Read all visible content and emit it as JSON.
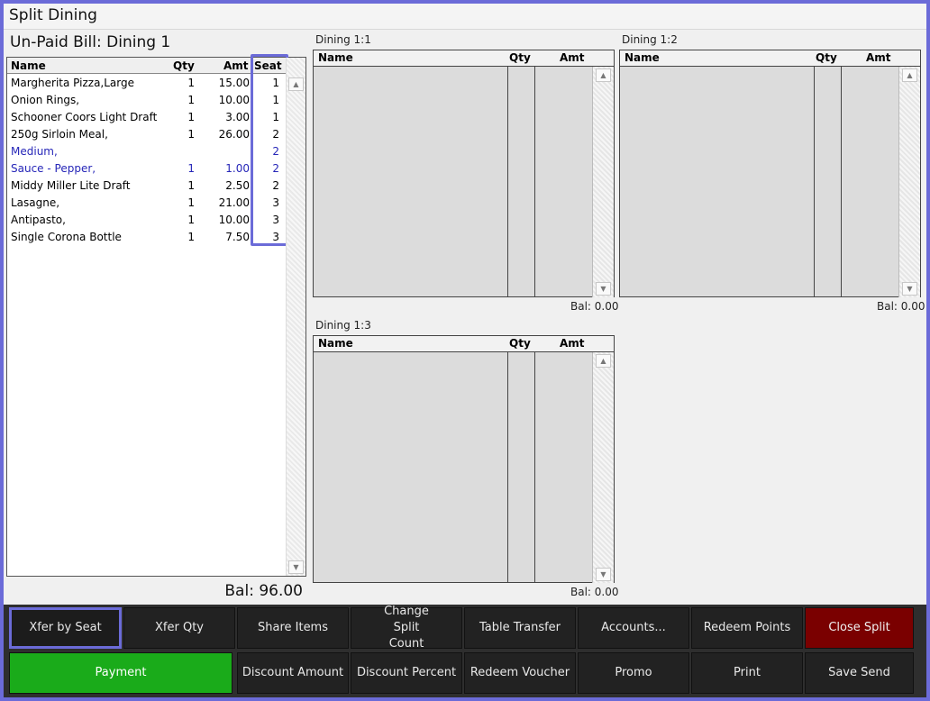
{
  "window": {
    "title": "Split Dining"
  },
  "bill": {
    "title": "Un-Paid Bill: Dining 1",
    "columns": {
      "name": "Name",
      "qty": "Qty",
      "amt": "Amt",
      "seat": "Seat"
    },
    "items": [
      {
        "name": "Margherita Pizza,Large",
        "qty": "1",
        "amt": "15.00",
        "seat": "1",
        "modifier": false
      },
      {
        "name": "Onion Rings,",
        "qty": "1",
        "amt": "10.00",
        "seat": "1",
        "modifier": false
      },
      {
        "name": "Schooner Coors Light Draft",
        "qty": "1",
        "amt": "3.00",
        "seat": "1",
        "modifier": false
      },
      {
        "name": "250g Sirloin Meal,",
        "qty": "1",
        "amt": "26.00",
        "seat": "2",
        "modifier": false
      },
      {
        "name": " Medium,",
        "qty": "",
        "amt": "",
        "seat": "2",
        "modifier": true
      },
      {
        "name": " Sauce - Pepper,",
        "qty": "1",
        "amt": "1.00",
        "seat": "2",
        "modifier": true
      },
      {
        "name": "Middy Miller Lite Draft",
        "qty": "1",
        "amt": "2.50",
        "seat": "2",
        "modifier": false
      },
      {
        "name": "Lasagne,",
        "qty": "1",
        "amt": "21.00",
        "seat": "3",
        "modifier": false
      },
      {
        "name": "Antipasto,",
        "qty": "1",
        "amt": "10.00",
        "seat": "3",
        "modifier": false
      },
      {
        "name": "Single Corona Bottle",
        "qty": "1",
        "amt": "7.50",
        "seat": "3",
        "modifier": false
      }
    ],
    "balance": "Bal: 96.00"
  },
  "splits": [
    {
      "label": "Dining 1:1",
      "columns": {
        "name": "Name",
        "qty": "Qty",
        "amt": "Amt"
      },
      "balance": "Bal: 0.00"
    },
    {
      "label": "Dining 1:2",
      "columns": {
        "name": "Name",
        "qty": "Qty",
        "amt": "Amt"
      },
      "balance": "Bal: 0.00"
    },
    {
      "label": "Dining 1:3",
      "columns": {
        "name": "Name",
        "qty": "Qty",
        "amt": "Amt"
      },
      "balance": "Bal: 0.00"
    }
  ],
  "scroll": {
    "up": "▲",
    "down": "▼"
  },
  "buttons": {
    "row1": [
      {
        "label": "Xfer by Seat",
        "selected": true
      },
      {
        "label": "Xfer Qty"
      },
      {
        "label": "Share Items"
      },
      {
        "label": "Change Split Count"
      },
      {
        "label": "Table Transfer"
      },
      {
        "label": "Accounts..."
      },
      {
        "label": "Redeem Points"
      },
      {
        "label": "Close Split",
        "color": "#7a0000"
      }
    ],
    "row2": [
      {
        "label": "Payment",
        "color": "#1aab1a"
      },
      {
        "label": "Discount Amount"
      },
      {
        "label": "Discount Percent"
      },
      {
        "label": "Redeem Voucher"
      },
      {
        "label": "Promo"
      },
      {
        "label": "Print"
      },
      {
        "label": "Save Send"
      }
    ]
  },
  "colors": {
    "accent": "#6b6bd8",
    "modifier_text": "#2626b8",
    "payment": "#1aab1a",
    "close_split": "#7a0000"
  }
}
